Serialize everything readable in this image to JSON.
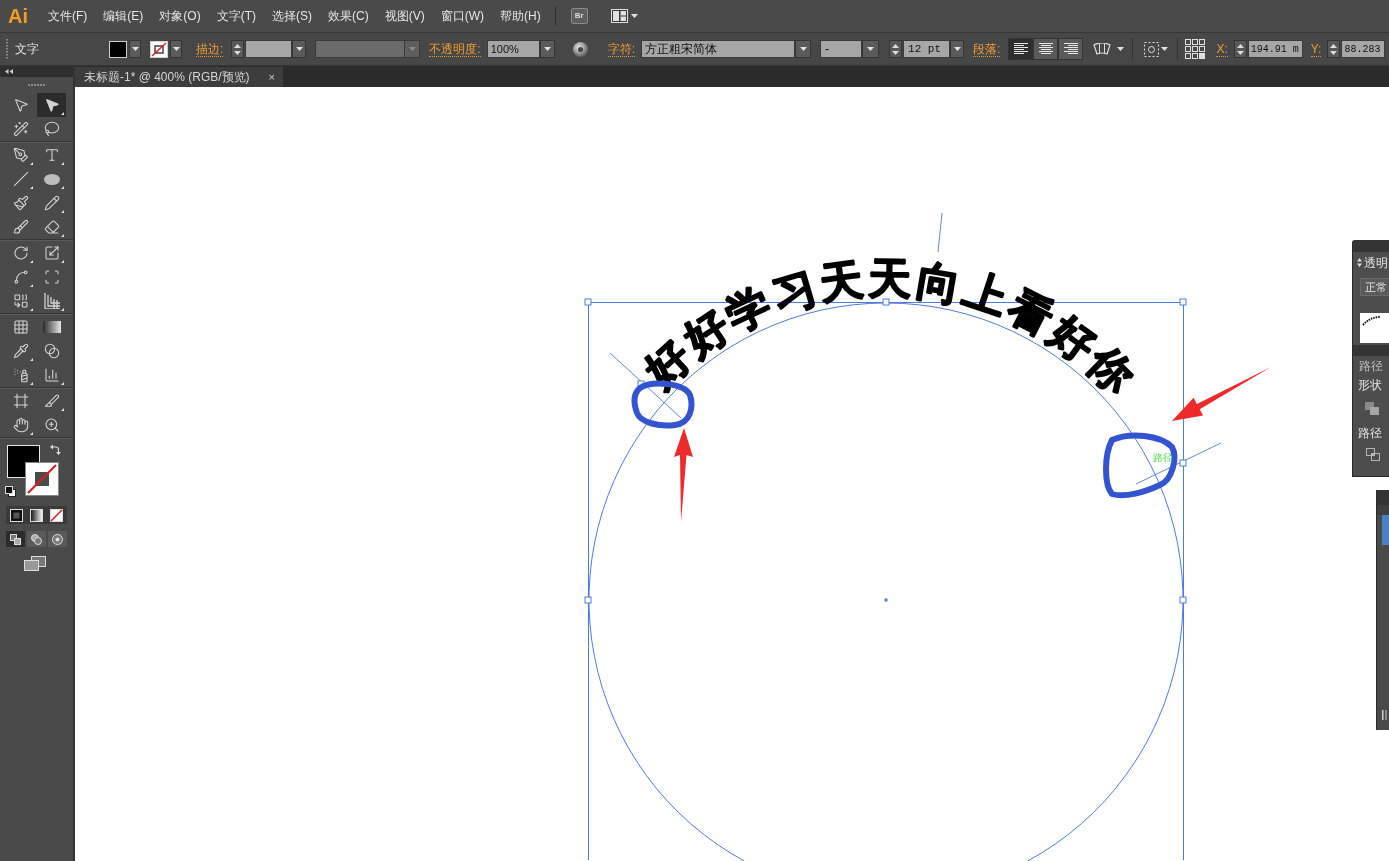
{
  "menu_bar": {
    "logo": "Ai",
    "menus": [
      "文件(F)",
      "编辑(E)",
      "对象(O)",
      "文字(T)",
      "选择(S)",
      "效果(C)",
      "视图(V)",
      "窗口(W)",
      "帮助(H)"
    ],
    "bridge_button": "Br"
  },
  "control_bar": {
    "tool_name": "文字",
    "stroke_label": "描边:",
    "brush_dropdown": {
      "disabled": true
    },
    "opacity_label": "不透明度:",
    "opacity": "100%",
    "character_label": "字符:",
    "font_family": "方正粗宋简体",
    "font_style": "-",
    "font_size": "12 pt",
    "paragraph_label": "段落:",
    "align_buttons": [
      {
        "selected": true
      },
      {
        "selected": false
      },
      {
        "selected": false
      }
    ],
    "x_label": "X:",
    "x_value": "194.91 m",
    "y_label": "Y:",
    "y_value": "88.283"
  },
  "document_tab": {
    "title": "未标题-1* @ 400% (RGB/预览)",
    "close": "×"
  },
  "toolbar": {
    "tools": [
      {
        "selected": false
      },
      {
        "selected": true
      },
      {
        "selected": false
      },
      {
        "selected": false
      },
      {
        "selected": false
      },
      {
        "selected": false
      },
      {
        "selected": false
      },
      {
        "selected": false
      },
      {
        "selected": false
      },
      {
        "selected": false
      },
      {
        "selected": false
      },
      {
        "selected": false
      },
      {
        "selected": false
      },
      {
        "selected": false
      },
      {
        "selected": false
      },
      {
        "selected": false
      },
      {
        "selected": false
      },
      {
        "selected": false
      },
      {
        "selected": false
      },
      {
        "selected": false
      },
      {
        "selected": false
      },
      {
        "selected": false
      },
      {
        "selected": false
      },
      {
        "selected": false
      },
      {
        "selected": false
      },
      {
        "selected": false
      },
      {
        "selected": false
      },
      {
        "selected": false
      }
    ],
    "draw_modes": [
      {
        "selected": true
      },
      {
        "selected": false
      },
      {
        "selected": false
      }
    ]
  },
  "canvas": {
    "path_text": "好好学习天天向上看好你",
    "smart_guide_label": "路径"
  },
  "panels": {
    "transparency": {
      "tab": "透明",
      "blend_mode": "正常"
    },
    "pathfinder": {
      "tab": "路径",
      "shape_modes_label": "形状",
      "pathfinders_label": "路径"
    }
  }
}
